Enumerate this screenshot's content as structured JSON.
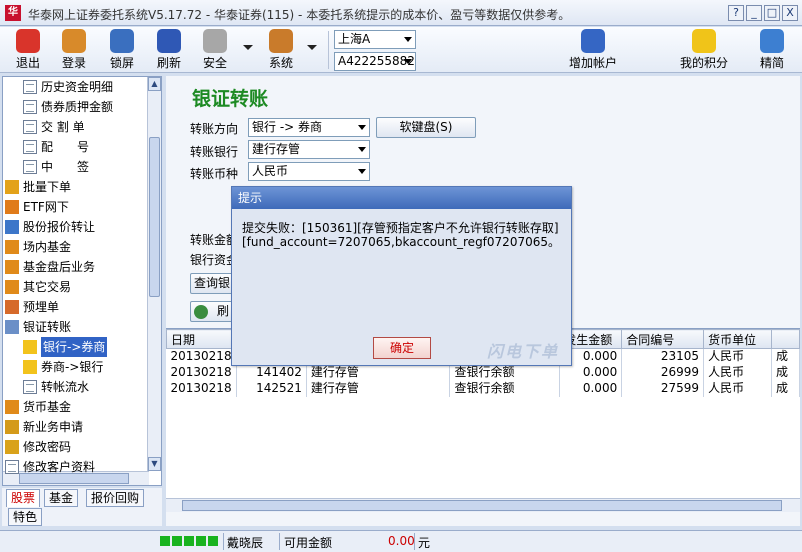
{
  "window": {
    "title": "华泰网上证券委托系统V5.17.72 - 华泰证券(115) - 本委托系统提示的成本价、盈亏等数据仅供参考。",
    "icon_text": "华",
    "buttons": [
      "?",
      "_",
      "□",
      "X"
    ]
  },
  "toolbar": {
    "items": [
      {
        "label": "退出",
        "icon": "power-icon",
        "color": "#d9342b"
      },
      {
        "label": "登录",
        "icon": "users-icon",
        "color": "#d88a2a"
      },
      {
        "label": "锁屏",
        "icon": "lock-icon",
        "color": "#3a6fbf"
      },
      {
        "label": "刷新",
        "icon": "refresh-icon",
        "color": "#2f58b5"
      },
      {
        "label": "安全",
        "icon": "key-icon",
        "color": "#a7a7a7"
      },
      {
        "label": "系统",
        "icon": "tools-icon",
        "color": "#c97b2b"
      },
      {
        "label": "增加帐户",
        "icon": "add-account-icon",
        "color": "#3566c4"
      },
      {
        "label": "我的积分",
        "icon": "stars-icon",
        "color": "#f0c419"
      },
      {
        "label": "精简",
        "icon": "compact-icon",
        "color": "#3d7fd1"
      }
    ],
    "market_select": "上海A",
    "account_select": "A422255882"
  },
  "nav": {
    "items": [
      {
        "label": "历史资金明细",
        "icon": "document-icon",
        "level": 2
      },
      {
        "label": "债券质押金额",
        "icon": "document-icon",
        "level": 2
      },
      {
        "label": "交 割 单",
        "icon": "document-icon",
        "level": 2
      },
      {
        "label": "配　　号",
        "icon": "document-icon",
        "level": 2
      },
      {
        "label": "中　　签",
        "icon": "document-icon",
        "level": 2
      },
      {
        "label": "批量下单",
        "icon": "batch-order-icon",
        "level": 1
      },
      {
        "label": "ETF网下",
        "icon": "etf-icon",
        "level": 1
      },
      {
        "label": "股份报价转让",
        "icon": "check-icon",
        "level": 1
      },
      {
        "label": "场内基金",
        "icon": "fund-icon",
        "level": 1
      },
      {
        "label": "基金盘后业务",
        "icon": "fund-icon",
        "level": 1
      },
      {
        "label": "其它交易",
        "icon": "fund-icon",
        "level": 1
      },
      {
        "label": "预埋单",
        "icon": "preorder-icon",
        "level": 1
      },
      {
        "label": "银证转账",
        "icon": "folder-icon",
        "level": 1
      },
      {
        "label": "银行->券商",
        "icon": "star-icon",
        "level": 2,
        "selected": true
      },
      {
        "label": "券商->银行",
        "icon": "star-icon",
        "level": 2
      },
      {
        "label": "转帐流水",
        "icon": "document-icon",
        "level": 2
      },
      {
        "label": "货币基金",
        "icon": "fund-icon",
        "level": 1
      },
      {
        "label": "新业务申请",
        "icon": "pencil-icon",
        "level": 1
      },
      {
        "label": "修改密码",
        "icon": "key-icon",
        "level": 1
      },
      {
        "label": "修改客户资料",
        "icon": "document-icon",
        "level": 1
      }
    ],
    "tabs": [
      "股票",
      "基金",
      "报价回购",
      "特色"
    ]
  },
  "main": {
    "title": "银证转账",
    "direction_label": "转账方向",
    "direction_value": "银行 -> 券商",
    "bank_label": "转账银行",
    "bank_value": "建行存管",
    "currency_label": "转账币种",
    "currency_value": "人民币",
    "amount_label": "转账金额",
    "bank_funds_label": "银行资金",
    "soft_keyboard": "软键盘(S)",
    "query_button": "查询银",
    "refresh_button": "刷",
    "table": {
      "columns": [
        "日期",
        "",
        "",
        "",
        "发生金额",
        "合同编号",
        "货币单位",
        ""
      ],
      "rows": [
        [
          "20130218",
          "",
          "",
          "",
          "0.000",
          "23105",
          "人民币",
          "成"
        ],
        [
          "20130218",
          "141402",
          "建行存管",
          "查银行余额",
          "0.000",
          "26999",
          "人民币",
          "成"
        ],
        [
          "20130218",
          "142521",
          "建行存管",
          "查银行余额",
          "0.000",
          "27599",
          "人民币",
          "成"
        ]
      ]
    }
  },
  "dialog": {
    "title": "提示",
    "message": "提交失败：[150361][存管预指定客户不允许银行转账存取][fund_account=7207065,bkaccount_regf07207065。",
    "ok_button": "确定",
    "watermark": "闪电下单"
  },
  "status": {
    "user": "戴晓辰",
    "available_label": "可用金额",
    "available_value": "0.00",
    "unit": "元"
  }
}
